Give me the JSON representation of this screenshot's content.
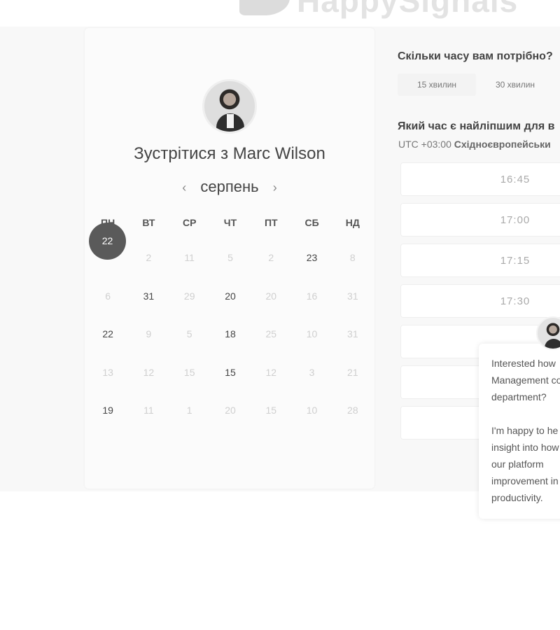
{
  "brand": {
    "name": "HappySignals"
  },
  "meeting": {
    "title": "Зустрітися з Marc Wilson"
  },
  "calendar": {
    "month": "серпень",
    "prev_arrow": "‹",
    "next_arrow": "›",
    "weekdays": [
      "ПН",
      "ВТ",
      "СР",
      "ЧТ",
      "ПТ",
      "СБ",
      "НД"
    ],
    "selected_day": "22",
    "rows": [
      [
        "22",
        "2",
        "11",
        "5",
        "2",
        "23",
        "8"
      ],
      [
        "6",
        "31",
        "29",
        "20",
        "20",
        "16",
        "31"
      ],
      [
        "22",
        "9",
        "5",
        "18",
        "25",
        "10",
        "31"
      ],
      [
        "13",
        "12",
        "15",
        "15",
        "12",
        "3",
        "21"
      ],
      [
        "19",
        "11",
        "1",
        "20",
        "15",
        "10",
        "28"
      ]
    ],
    "available": [
      [
        false,
        false,
        false,
        false,
        false,
        true,
        false
      ],
      [
        false,
        true,
        false,
        true,
        false,
        false,
        false
      ],
      [
        true,
        false,
        false,
        true,
        false,
        false,
        false
      ],
      [
        false,
        false,
        false,
        true,
        false,
        false,
        false
      ],
      [
        true,
        false,
        false,
        false,
        false,
        false,
        false
      ]
    ]
  },
  "duration": {
    "question": "Скільки часу вам потрібно?",
    "options": [
      "15 хвилин",
      "30 хвилин"
    ],
    "active_option": "15 хвилин"
  },
  "times": {
    "question": "Який час є найліпшим для в",
    "timezone_offset": "UTC +03:00",
    "timezone_name": "Східноєвропейськи",
    "slots": [
      "16:45",
      "17:00",
      "17:15",
      "17:30",
      "",
      "",
      ""
    ]
  },
  "chat": {
    "message_1": "Interested how Management co department?",
    "message_2": "I'm happy to he insight into how use our platform improvement in productivity."
  },
  "colors": {
    "selected_day_bg": "#5a5a5a",
    "muted_day": "#cfcfcf"
  }
}
